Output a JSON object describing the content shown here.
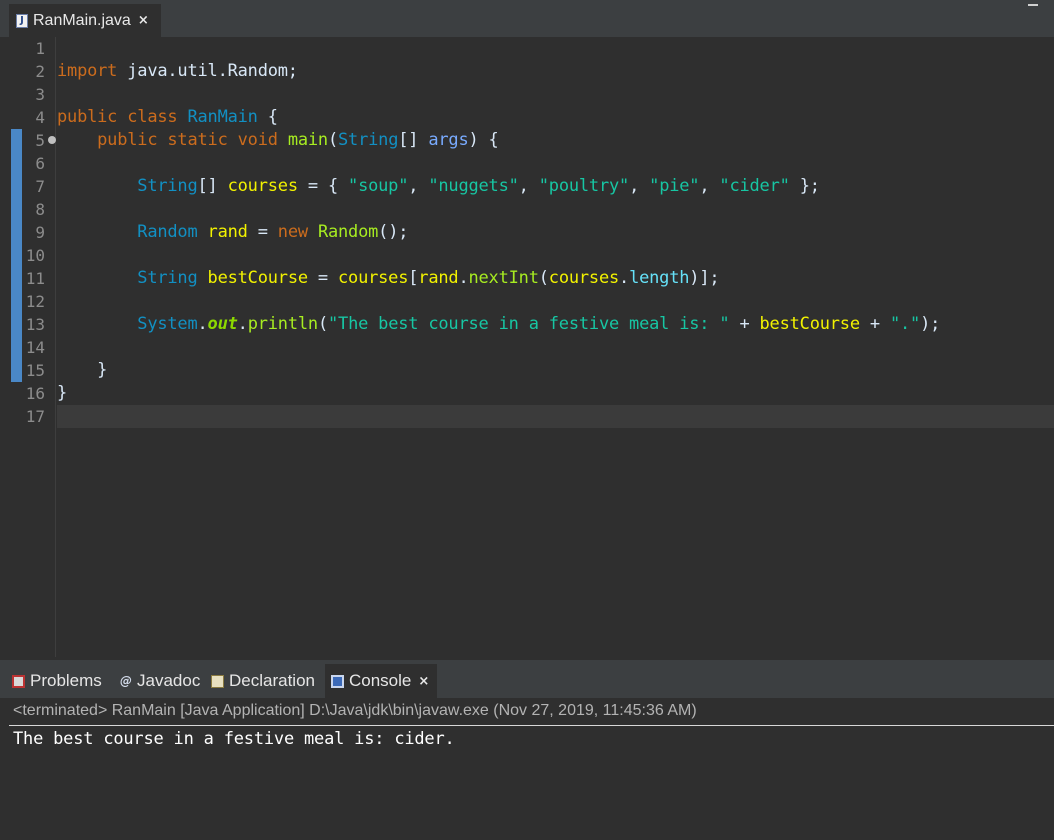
{
  "editor_tab": {
    "label": "RanMain.java",
    "close": "×"
  },
  "gutter": {
    "line_numbers": [
      "1",
      "2",
      "3",
      "4",
      "5",
      "6",
      "7",
      "8",
      "9",
      "10",
      "11",
      "12",
      "13",
      "14",
      "15",
      "16",
      "17"
    ]
  },
  "code": {
    "line2": {
      "import": "import",
      "pkg": " java.util.Random;"
    },
    "line4": {
      "public": "public",
      "class": " class ",
      "name": "RanMain",
      "brace": " {"
    },
    "line5": {
      "indent": "    ",
      "public": "public",
      "static": " static",
      "void": " void ",
      "main": "main",
      "open": "(",
      "string": "String",
      "arr": "[] ",
      "args": "args",
      "close": ") {"
    },
    "line7": {
      "indent": "        ",
      "string": "String",
      "arr": "[] ",
      "courses": "courses",
      "eq": " = { ",
      "s1": "\"soup\"",
      "c1": ", ",
      "s2": "\"nuggets\"",
      "c2": ", ",
      "s3": "\"poultry\"",
      "c3": ", ",
      "s4": "\"pie\"",
      "c4": ", ",
      "s5": "\"cider\"",
      "end": " };"
    },
    "line9": {
      "indent": "        ",
      "type": "Random",
      "rand": " rand",
      "eq": " = ",
      "new": "new",
      "sp": " ",
      "ctor": "Random",
      "end": "();"
    },
    "line11": {
      "indent": "        ",
      "type": "String",
      "best": " bestCourse",
      "eq": " = ",
      "courses": "courses",
      "br": "[",
      "rand": "rand",
      "dot": ".",
      "next": "nextInt",
      "paren": "(",
      "courses2": "courses",
      "dot2": ".",
      "length": "length",
      "end": ")];"
    },
    "line13": {
      "indent": "        ",
      "system": "System",
      "dot": ".",
      "out": "out",
      "dot2": ".",
      "println": "println",
      "paren": "(",
      "str1": "\"The best course in a festive meal is: \"",
      "plus1": " + ",
      "best": "bestCourse",
      "plus2": " + ",
      "str2": "\".\"",
      "end": ");"
    },
    "line15": {
      "text": "    }"
    },
    "line16": {
      "text": "}"
    }
  },
  "view_tabs": [
    {
      "label": "Problems",
      "icon": "problems-icon"
    },
    {
      "label": "Javadoc",
      "icon": "javadoc-icon"
    },
    {
      "label": "Declaration",
      "icon": "declaration-icon"
    },
    {
      "label": "Console",
      "icon": "console-icon",
      "active": true,
      "close": "×"
    }
  ],
  "javadoc_glyph": "@",
  "console": {
    "status": "<terminated> RanMain [Java Application] D:\\Java\\jdk\\bin\\javaw.exe (Nov 27, 2019, 11:45:36 AM)",
    "output": "The best course in a festive meal is: cider."
  },
  "colors": {
    "background": "#2f2f2f",
    "keyword": "#cc6c1d",
    "type": "#1290c3",
    "variable": "#f2f200",
    "string": "#17c6a3",
    "method": "#a7ec21",
    "field": "#66e1f8",
    "change_bar": "#4a88c7"
  }
}
